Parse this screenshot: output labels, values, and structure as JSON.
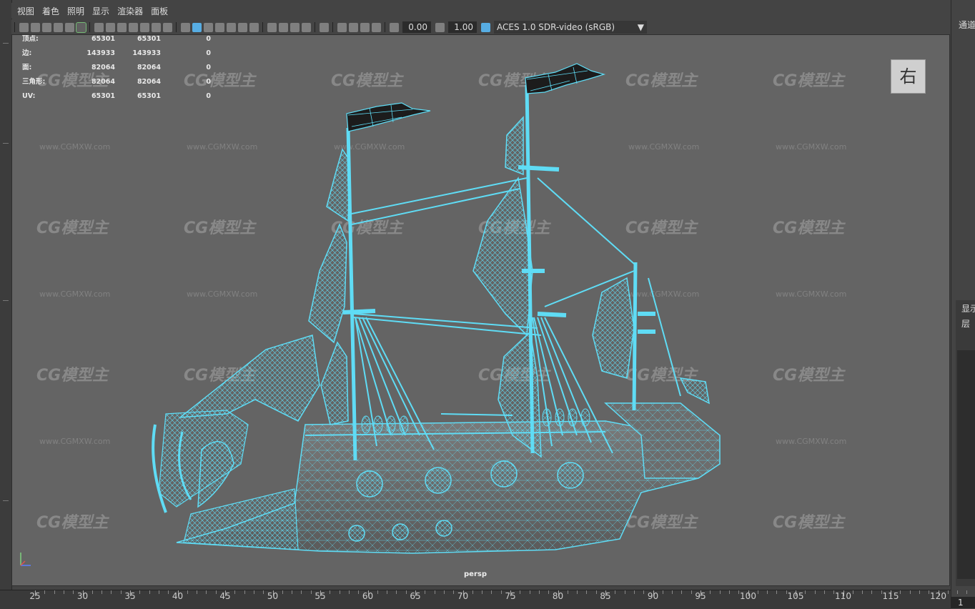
{
  "menu": [
    "视图",
    "着色",
    "照明",
    "显示",
    "渲染器",
    "面板"
  ],
  "toolbar": {
    "exposure": "0.00",
    "gamma": "1.00",
    "colorspace": "ACES 1.0 SDR-video (sRGB)"
  },
  "hud": [
    {
      "label": "顶点:",
      "v1": "65301",
      "v2": "65301",
      "v3": "0"
    },
    {
      "label": "边:",
      "v1": "143933",
      "v2": "143933",
      "v3": "0"
    },
    {
      "label": "面:",
      "v1": "82064",
      "v2": "82064",
      "v3": "0"
    },
    {
      "label": "三角形:",
      "v1": "82064",
      "v2": "82064",
      "v3": "0"
    },
    {
      "label": "UV:",
      "v1": "65301",
      "v2": "65301",
      "v3": "0"
    }
  ],
  "viewcube_label": "右",
  "camera_label": "persp",
  "watermark": {
    "logo": "CG模型主",
    "url": "www.CGMXW.com"
  },
  "right_panel": {
    "tab": "通道",
    "display_label": "显示",
    "layers_label": "层"
  },
  "timeline": {
    "labels": [
      "25",
      "30",
      "35",
      "40",
      "45",
      "50",
      "55",
      "60",
      "65",
      "70",
      "75",
      "80",
      "85",
      "90",
      "95",
      "100",
      "105",
      "110",
      "115",
      "120"
    ],
    "current_frame": "1"
  },
  "colors": {
    "wireframe": "#5fdcf5",
    "viewport_bg": "#646464"
  }
}
